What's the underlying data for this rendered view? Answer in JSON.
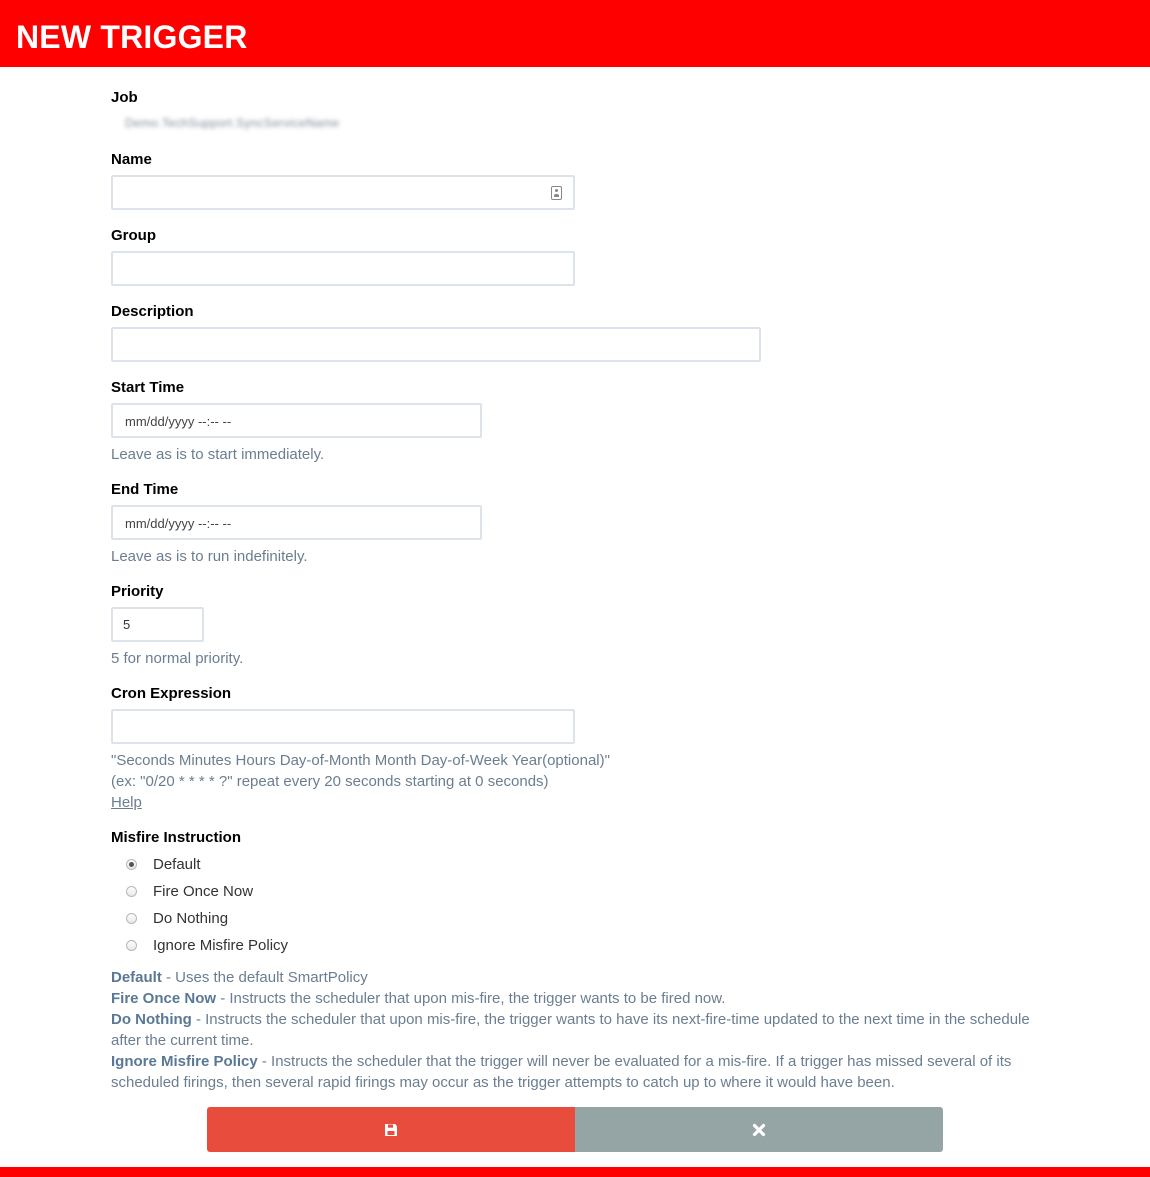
{
  "header": {
    "title": "NEW TRIGGER"
  },
  "form": {
    "job": {
      "label": "Job",
      "value": "Demo.TechSupport.SyncServiceName"
    },
    "name": {
      "label": "Name",
      "value": ""
    },
    "group": {
      "label": "Group",
      "value": ""
    },
    "description": {
      "label": "Description",
      "value": ""
    },
    "start_time": {
      "label": "Start Time",
      "value": "mm/dd/yyyy  --:-- --",
      "help": "Leave as is to start immediately."
    },
    "end_time": {
      "label": "End Time",
      "value": "mm/dd/yyyy  --:-- --",
      "help": "Leave as is to run indefinitely."
    },
    "priority": {
      "label": "Priority",
      "value": "5",
      "help": "5 for normal priority."
    },
    "cron": {
      "label": "Cron Expression",
      "value": "",
      "help_line1": "\"Seconds Minutes Hours Day-of-Month Month Day-of-Week Year(optional)\"",
      "help_line2": "(ex: \"0/20 * * * * ?\" repeat every 20 seconds starting at 0 seconds)",
      "help_link": "Help"
    },
    "misfire": {
      "label": "Misfire Instruction",
      "selected": "Default",
      "options": [
        "Default",
        "Fire Once Now",
        "Do Nothing",
        "Ignore Misfire Policy"
      ],
      "descriptions": [
        {
          "term": "Default",
          "text": " - Uses the default SmartPolicy"
        },
        {
          "term": "Fire Once Now",
          "text": " - Instructs the scheduler that upon mis-fire, the trigger wants to be fired now."
        },
        {
          "term": "Do Nothing",
          "text": " - Instructs the scheduler that upon mis-fire, the trigger wants to have its next-fire-time updated to the next time in the schedule after the current time."
        },
        {
          "term": "Ignore Misfire Policy",
          "text": " - Instructs the scheduler that the trigger will never be evaluated for a mis-fire. If a trigger has missed several of its scheduled firings, then several rapid firings may occur as the trigger attempts to catch up to where it would have been."
        }
      ]
    }
  },
  "buttons": {
    "save_icon": "save-icon",
    "cancel_icon": "close-icon"
  },
  "colors": {
    "header": "#ff0000",
    "save": "#e74c3c",
    "cancel": "#95a5a6",
    "help_text": "#6b7e90"
  }
}
